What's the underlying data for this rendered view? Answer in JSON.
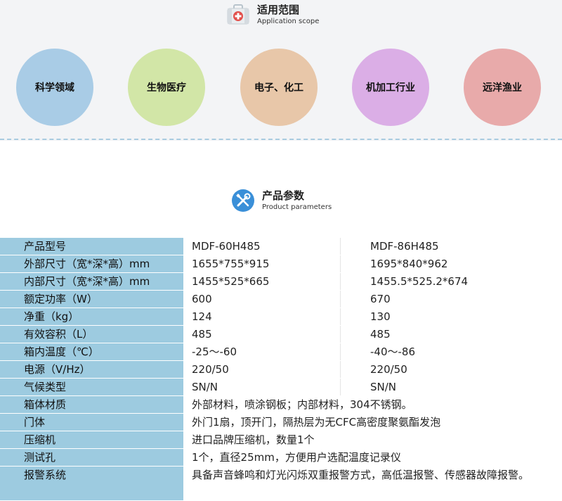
{
  "scope": {
    "title": "适用范围",
    "subtitle": "Application scope",
    "items": [
      "科学领域",
      "生物医疗",
      "电子、化工",
      "机加工行业",
      "远洋渔业"
    ]
  },
  "params": {
    "title": "产品参数",
    "subtitle": "Product parameters"
  },
  "specs": [
    {
      "label": "产品型号",
      "v1": "MDF-60H485",
      "v2": "MDF-86H485"
    },
    {
      "label": "外部尺寸（宽*深*高）mm",
      "v1": "1655*755*915",
      "v2": "1695*840*962"
    },
    {
      "label": "内部尺寸（宽*深*高）mm",
      "v1": "1455*525*665",
      "v2": "1455.5*525.2*674"
    },
    {
      "label": "额定功率（W）",
      "v1": "600",
      "v2": "670"
    },
    {
      "label": "净重（kg）",
      "v1": "124",
      "v2": "130"
    },
    {
      "label": "有效容积（L）",
      "v1": "485",
      "v2": "485"
    },
    {
      "label": "箱内温度（℃）",
      "v1": "-25～-60",
      "v2": "-40～-86"
    },
    {
      "label": "电源（V/Hz）",
      "v1": "220/50",
      "v2": "220/50"
    },
    {
      "label": "气候类型",
      "v1": "SN/N",
      "v2": "SN/N"
    },
    {
      "label": "箱体材质",
      "full": "外部材料，喷涂钢板；内部材料，304不锈钢。"
    },
    {
      "label": "门体",
      "full": "外门1扇，顶开门，隔热层为无CFC高密度聚氨酯发泡"
    },
    {
      "label": "压缩机",
      "full": "进口品牌压缩机，数量1个"
    },
    {
      "label": "测试孔",
      "full": "1个，直径25mm，方便用户选配温度记录仪"
    },
    {
      "label": "报警系统",
      "full": "具备声音蜂鸣和灯光闪烁双重报警方式，高低温报警、传感器故障报警。"
    }
  ]
}
